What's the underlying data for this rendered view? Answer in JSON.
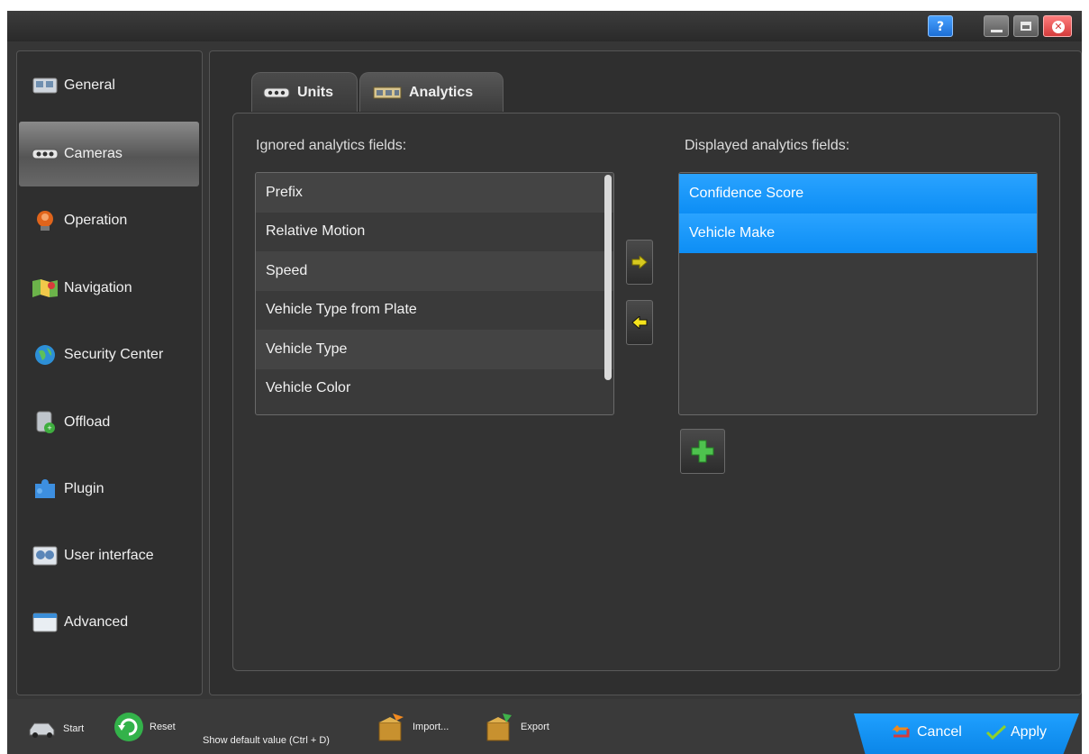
{
  "titlebar": {
    "help_label": "?"
  },
  "sidebar": {
    "items": [
      {
        "label": "General",
        "icon": "general-icon"
      },
      {
        "label": "Cameras",
        "icon": "camera-icon"
      },
      {
        "label": "Operation",
        "icon": "operation-icon"
      },
      {
        "label": "Navigation",
        "icon": "map-icon"
      },
      {
        "label": "Security Center",
        "icon": "globe-icon"
      },
      {
        "label": "Offload",
        "icon": "offload-icon"
      },
      {
        "label": "Plugin",
        "icon": "puzzle-icon"
      },
      {
        "label": "User interface",
        "icon": "user-interface-icon"
      },
      {
        "label": "Advanced",
        "icon": "advanced-icon"
      }
    ],
    "selected": "Cameras"
  },
  "tabs": [
    {
      "label": "Units",
      "icon": "camera-icon"
    },
    {
      "label": "Analytics",
      "icon": "analytics-icon"
    }
  ],
  "active_tab": "Analytics",
  "ignored": {
    "label": "Ignored analytics fields:",
    "items": [
      "Prefix",
      "Relative Motion",
      "Speed",
      "Vehicle Type from Plate",
      "Vehicle Type",
      "Vehicle Color"
    ]
  },
  "displayed": {
    "label": "Displayed analytics fields:",
    "items": [
      "Confidence Score",
      "Vehicle Make"
    ]
  },
  "footer": {
    "start": "Start",
    "reset": "Reset",
    "show_default": "Show default value (Ctrl + D)",
    "import": "Import...",
    "export": "Export",
    "cancel": "Cancel",
    "apply": "Apply"
  },
  "colors": {
    "accent": "#1a97f5",
    "selected_row": "#1a97f5",
    "background": "#363636"
  }
}
